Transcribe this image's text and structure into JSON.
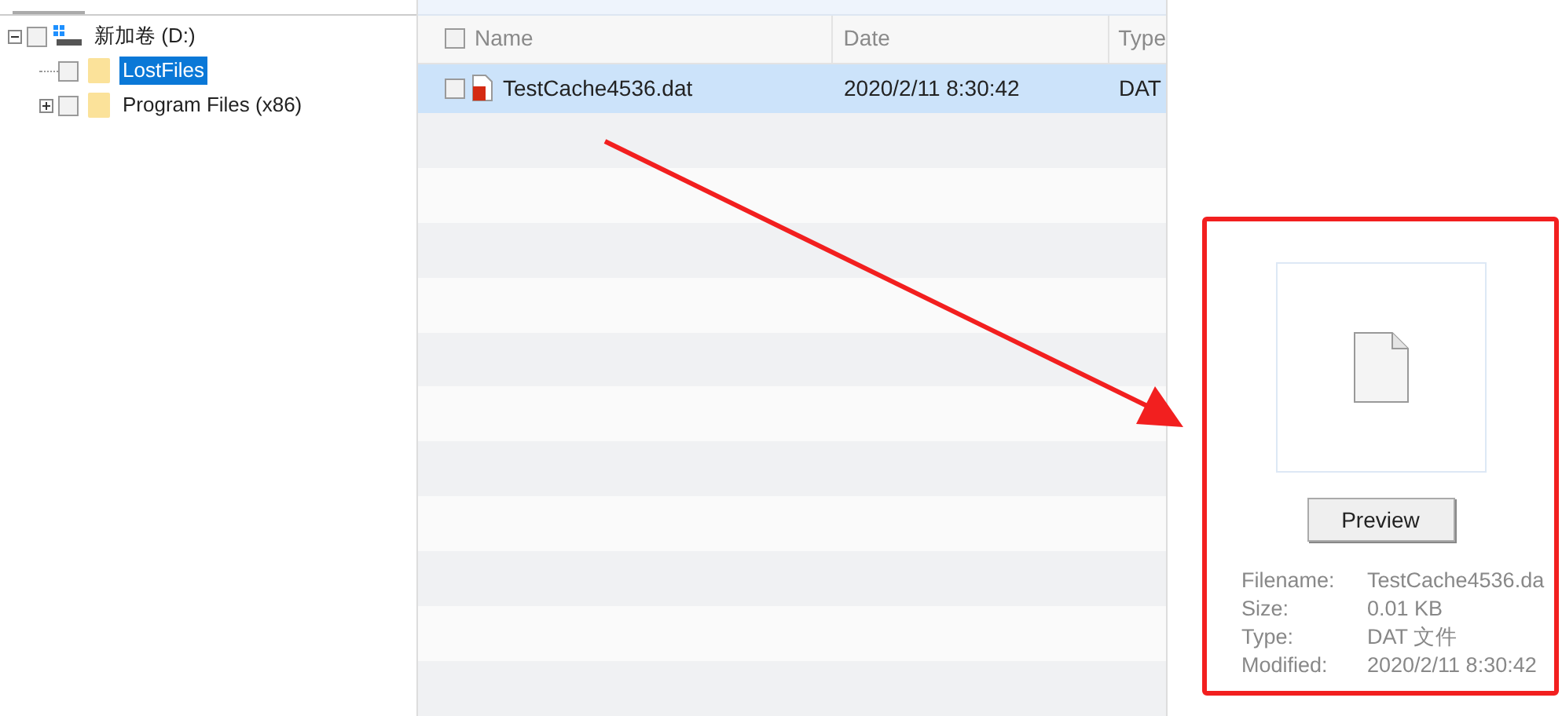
{
  "tree": [
    {
      "label": "新加卷 (D:)",
      "kind": "drive",
      "expanded": true,
      "checked": false,
      "selected": false,
      "children": [
        {
          "label": "LostFiles",
          "kind": "folder",
          "checked": false,
          "selected": true
        },
        {
          "label": "Program Files (x86)",
          "kind": "folder",
          "expanded": false,
          "checked": false,
          "selected": false
        }
      ]
    }
  ],
  "table": {
    "columns": [
      "Name",
      "Date",
      "Type"
    ],
    "rows": [
      {
        "name": "TestCache4536.dat",
        "date": "2020/2/11 8:30:42",
        "type": "DAT",
        "checked": false,
        "selected": true
      }
    ]
  },
  "preview": {
    "button": "Preview",
    "fields": [
      {
        "label": "Filename:",
        "value": "TestCache4536.da"
      },
      {
        "label": "Size:",
        "value": "0.01 KB"
      },
      {
        "label": "Type:",
        "value": "DAT 文件"
      },
      {
        "label": "Modified:",
        "value": "2020/2/11 8:30:42"
      }
    ]
  }
}
